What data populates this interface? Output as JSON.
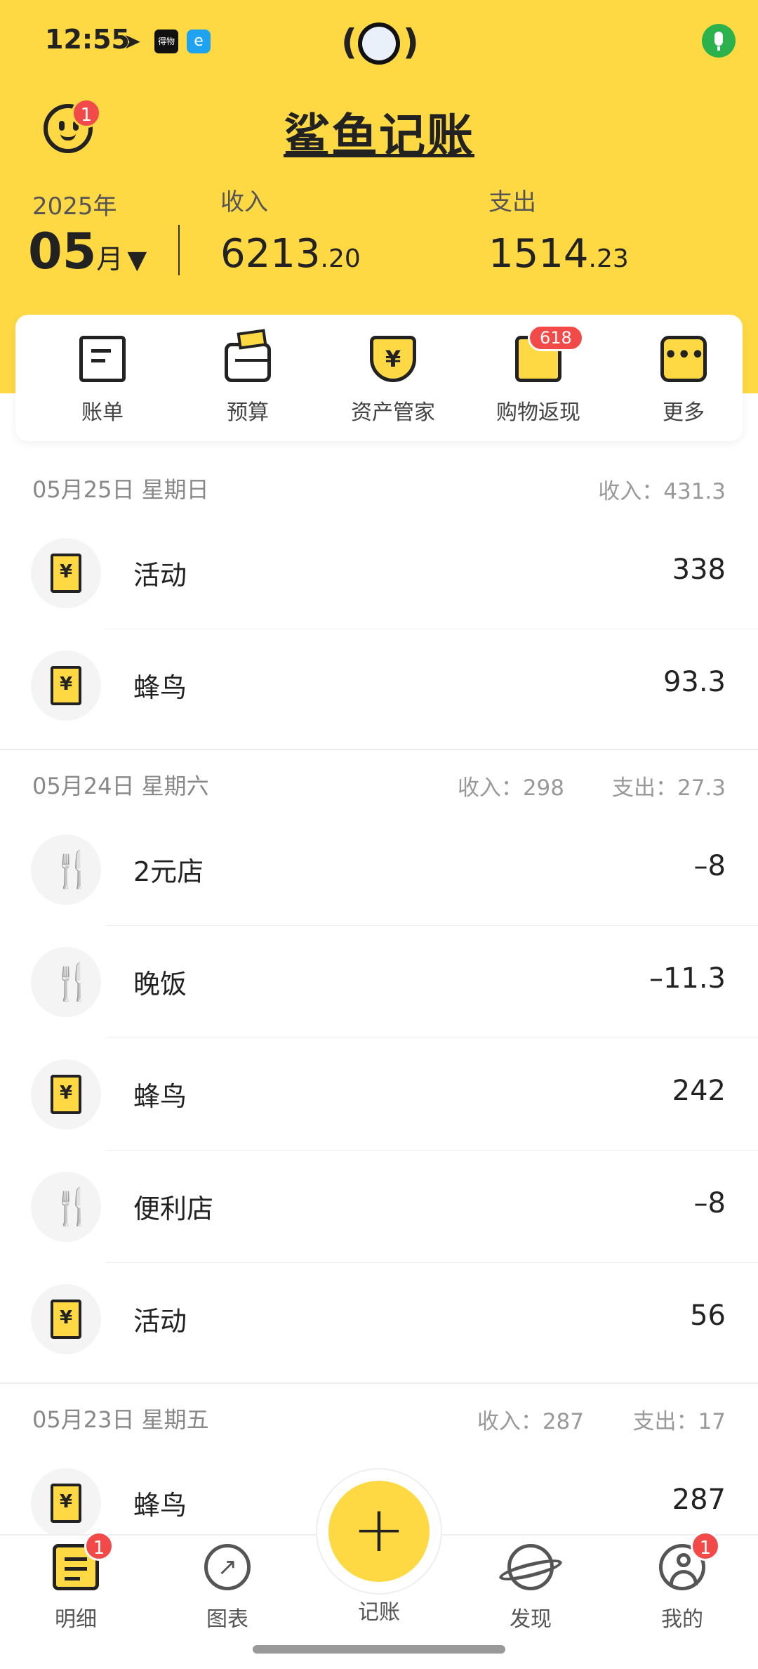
{
  "status_bar": {
    "time": "12:55",
    "app1": "得物",
    "app2": "e"
  },
  "header": {
    "title": "鲨鱼记账",
    "year": "2025年",
    "month": "05",
    "month_unit": "月",
    "income_label": "收入",
    "income_int": "6213",
    "income_dec": ".20",
    "expense_label": "支出",
    "expense_int": "1514",
    "expense_dec": ".23",
    "avatar_badge": "1",
    "colors": {
      "accent": "#FED944",
      "badge": "#F24A48"
    }
  },
  "quick_menu": [
    {
      "label": "账单",
      "icon": "bill-icon"
    },
    {
      "label": "预算",
      "icon": "wallet-icon"
    },
    {
      "label": "资产管家",
      "icon": "shield-yen-icon"
    },
    {
      "label": "购物返现",
      "icon": "shopping-bag-icon",
      "badge": "618"
    },
    {
      "label": "更多",
      "icon": "more-dots-icon"
    }
  ],
  "days": [
    {
      "date": "05月25日 星期日",
      "summary1": "收入：431.3",
      "items": [
        {
          "name": "活动",
          "value": "338",
          "icon": "receipt-icon"
        },
        {
          "name": "蜂鸟",
          "value": "93.3",
          "icon": "receipt-icon"
        }
      ]
    },
    {
      "date": "05月24日 星期六",
      "summary1": "收入：298",
      "summary2": "支出：27.3",
      "items": [
        {
          "name": "2元店",
          "value": "–8",
          "icon": "utensils-icon"
        },
        {
          "name": "晚饭",
          "value": "–11.3",
          "icon": "utensils-icon"
        },
        {
          "name": "蜂鸟",
          "value": "242",
          "icon": "receipt-icon"
        },
        {
          "name": "便利店",
          "value": "–8",
          "icon": "utensils-icon"
        },
        {
          "name": "活动",
          "value": "56",
          "icon": "receipt-icon"
        }
      ]
    },
    {
      "date": "05月23日 星期五",
      "summary1": "收入：287",
      "summary2": "支出：17",
      "items": [
        {
          "name": "蜂鸟",
          "value": "287",
          "icon": "receipt-icon"
        }
      ]
    }
  ],
  "bottom_nav": {
    "items": [
      {
        "label": "明细",
        "icon": "list-icon",
        "badge": "1"
      },
      {
        "label": "图表",
        "icon": "chart-icon"
      },
      {
        "label": "记账",
        "icon": "plus-icon"
      },
      {
        "label": "发现",
        "icon": "planet-icon"
      },
      {
        "label": "我的",
        "icon": "user-icon",
        "badge": "1"
      }
    ],
    "fab_symbol": "+"
  }
}
